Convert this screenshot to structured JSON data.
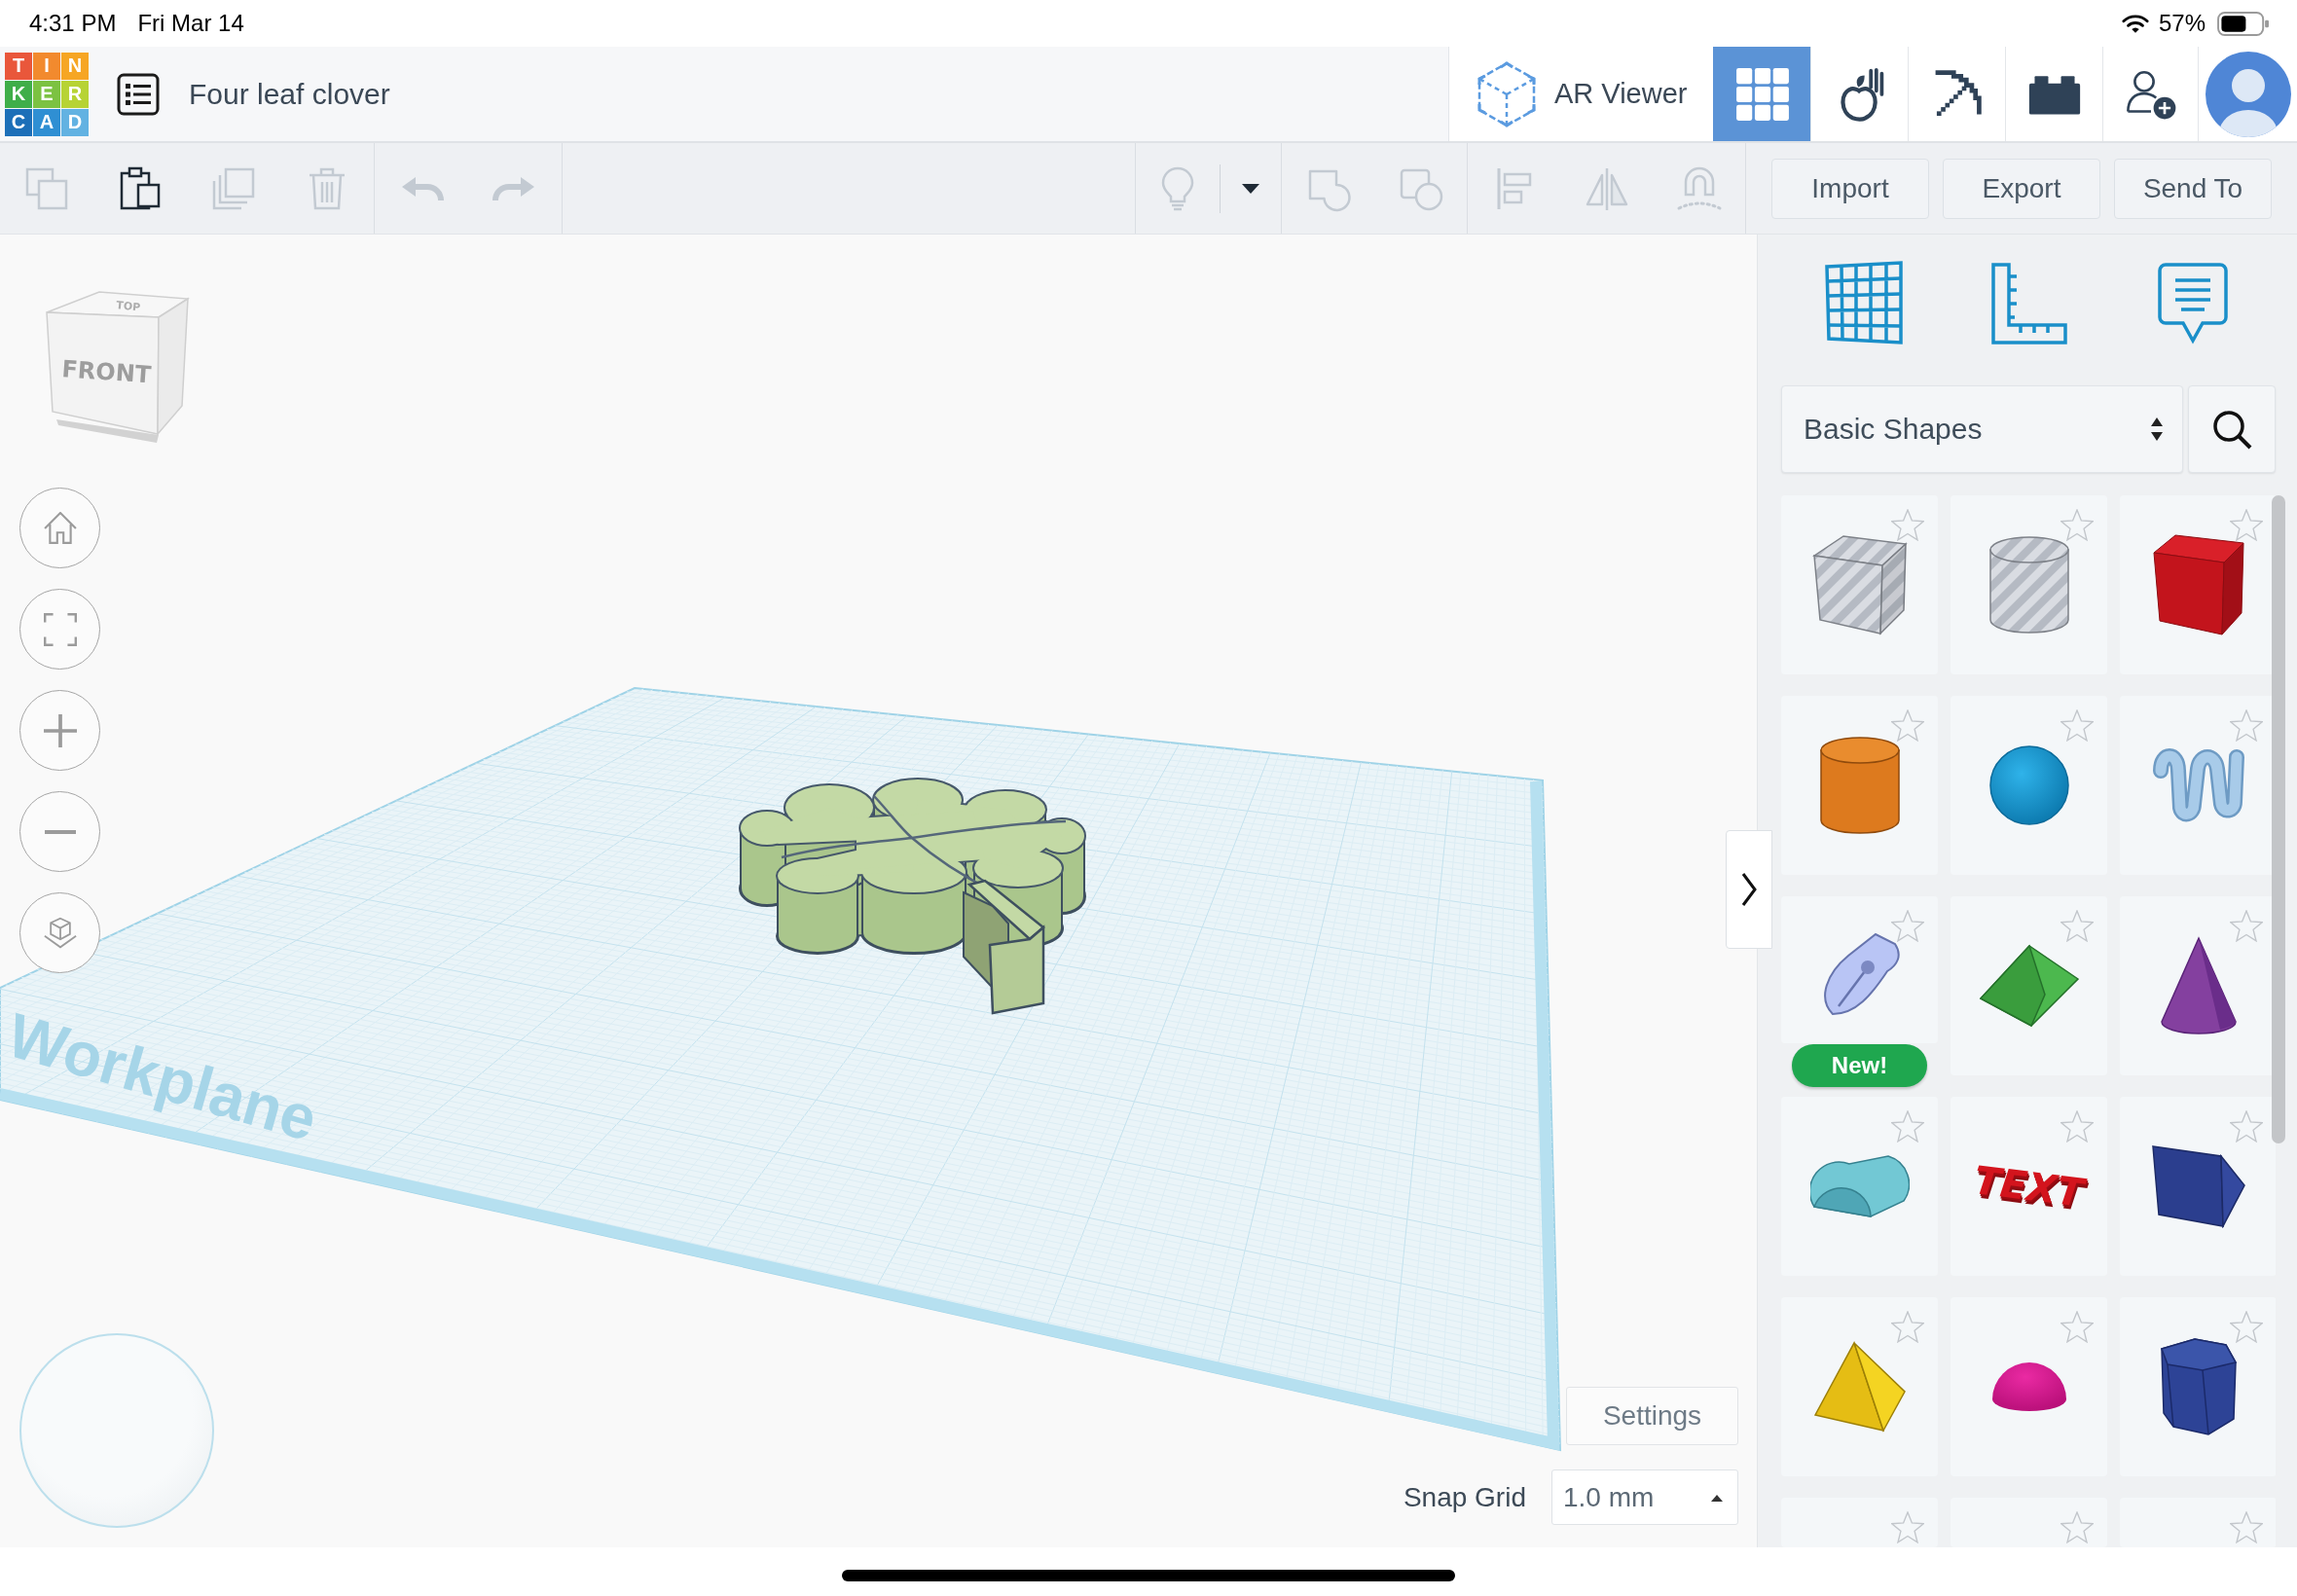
{
  "status_bar": {
    "time": "4:31 PM",
    "date": "Fri Mar 14",
    "battery": "57%"
  },
  "header": {
    "logo": [
      {
        "letter": "T",
        "color": "#e9573b"
      },
      {
        "letter": "I",
        "color": "#f28a2e"
      },
      {
        "letter": "N",
        "color": "#f6a623"
      },
      {
        "letter": "K",
        "color": "#3fae49"
      },
      {
        "letter": "E",
        "color": "#7cc242"
      },
      {
        "letter": "R",
        "color": "#b7d334"
      },
      {
        "letter": "C",
        "color": "#1c6fb8"
      },
      {
        "letter": "A",
        "color": "#2f8fd3"
      },
      {
        "letter": "D",
        "color": "#62b2e2"
      }
    ],
    "title": "Four leaf clover",
    "ar_viewer": "AR Viewer",
    "view_modes": [
      {
        "kind": "grid",
        "selected": true
      },
      {
        "kind": "physics",
        "selected": false
      },
      {
        "kind": "pickaxe",
        "selected": false
      },
      {
        "kind": "bricks",
        "selected": false
      }
    ]
  },
  "toolbar": {
    "left_groups": [
      [
        {
          "kind": "copy",
          "disabled": true
        },
        {
          "kind": "paste",
          "disabled": false
        },
        {
          "kind": "duplicate",
          "disabled": true
        },
        {
          "kind": "delete",
          "disabled": true
        }
      ],
      [
        {
          "kind": "undo",
          "disabled": true
        },
        {
          "kind": "redo",
          "disabled": true
        }
      ]
    ],
    "right_groups": [
      [
        {
          "kind": "light",
          "disabled": true
        },
        {
          "kind": "menu",
          "disabled": false
        }
      ],
      [
        {
          "kind": "group",
          "disabled": true
        },
        {
          "kind": "ungroup",
          "disabled": true
        }
      ],
      [
        {
          "kind": "align",
          "disabled": true
        },
        {
          "kind": "mirror",
          "disabled": true
        },
        {
          "kind": "cruise",
          "disabled": true
        }
      ]
    ],
    "actions": [
      "Import",
      "Export",
      "Send To"
    ]
  },
  "viewport": {
    "view_cube": {
      "front": "FRONT",
      "top": "TOP"
    },
    "workplane_label": "Workplane",
    "settings": "Settings",
    "snap_grid": {
      "label": "Snap Grid",
      "value": "1.0 mm"
    }
  },
  "shapes_panel": {
    "category": "Basic Shapes",
    "shapes": [
      {
        "kind": "box_hole",
        "favorite": false
      },
      {
        "kind": "cylinder_hole",
        "favorite": false
      },
      {
        "kind": "box",
        "favorite": false
      },
      {
        "kind": "cylinder",
        "favorite": false
      },
      {
        "kind": "sphere",
        "favorite": false
      },
      {
        "kind": "scribble",
        "favorite": false
      },
      {
        "kind": "sketch",
        "favorite": false,
        "badge": "New!"
      },
      {
        "kind": "roof",
        "favorite": false
      },
      {
        "kind": "cone",
        "favorite": false
      },
      {
        "kind": "round_roof",
        "favorite": false
      },
      {
        "kind": "text",
        "favorite": false,
        "text": "TEXT"
      },
      {
        "kind": "wedge",
        "favorite": false
      },
      {
        "kind": "pyramid",
        "favorite": false
      },
      {
        "kind": "half_sphere",
        "favorite": false
      },
      {
        "kind": "polygon",
        "favorite": false
      },
      {
        "kind": "cut_off",
        "favorite": false
      },
      {
        "kind": "cut_off",
        "favorite": false
      },
      {
        "kind": "cut_off",
        "favorite": false
      }
    ]
  }
}
